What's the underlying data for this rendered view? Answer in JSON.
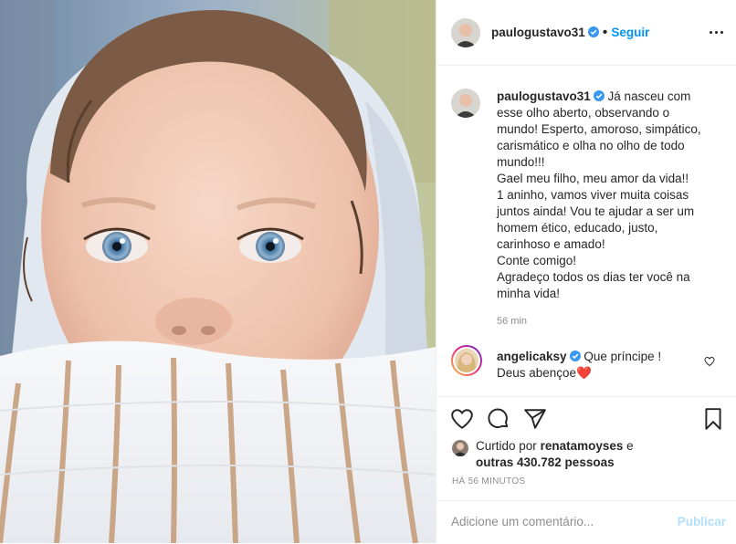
{
  "post": {
    "author": {
      "username": "paulogustavo31",
      "verified": true,
      "follow_label": "Seguir",
      "separator": "•"
    },
    "caption_lines": [
      "Já nasceu com",
      "esse olho aberto, observando o",
      "mundo! Esperto, amoroso, simpático,",
      "carismático e olha no olho de todo",
      "mundo!!!",
      "Gael meu filho, meu amor da vida!!",
      "1 aninho, vamos viver muita coisas",
      "juntos ainda! Vou te ajudar a ser um",
      "homem ético, educado, justo,",
      "carinhoso e amado!",
      "Conte comigo!",
      "Agradeço todos os dias ter você na",
      "minha vida!"
    ],
    "caption_time": "56 min",
    "comment": {
      "username": "angelicaksy",
      "verified": true,
      "text_line1": "Que príncipe !",
      "text_line2": "Deus abençoe",
      "emoji": "❤️"
    },
    "likes": {
      "prefix": "Curtido por",
      "liked_by": "renatamoyses",
      "conjunction": "e",
      "others": "outras 430.782 pessoas"
    },
    "posted_ago": "HÁ 56 MINUTOS",
    "comment_input": {
      "placeholder": "Adicione um comentário...",
      "publish_label": "Publicar"
    }
  },
  "icons": {
    "more": "more-options-icon",
    "like": "heart-outline-icon",
    "comment": "comment-bubble-icon",
    "share": "paper-plane-icon",
    "save": "bookmark-outline-icon",
    "verified": "verified-badge-icon"
  },
  "colors": {
    "accent_blue": "#0095f6",
    "verified_blue": "#3897f0",
    "muted_text": "#8e8e8e",
    "publish_disabled": "#b2dffc",
    "heart_red": "#ed4956"
  }
}
